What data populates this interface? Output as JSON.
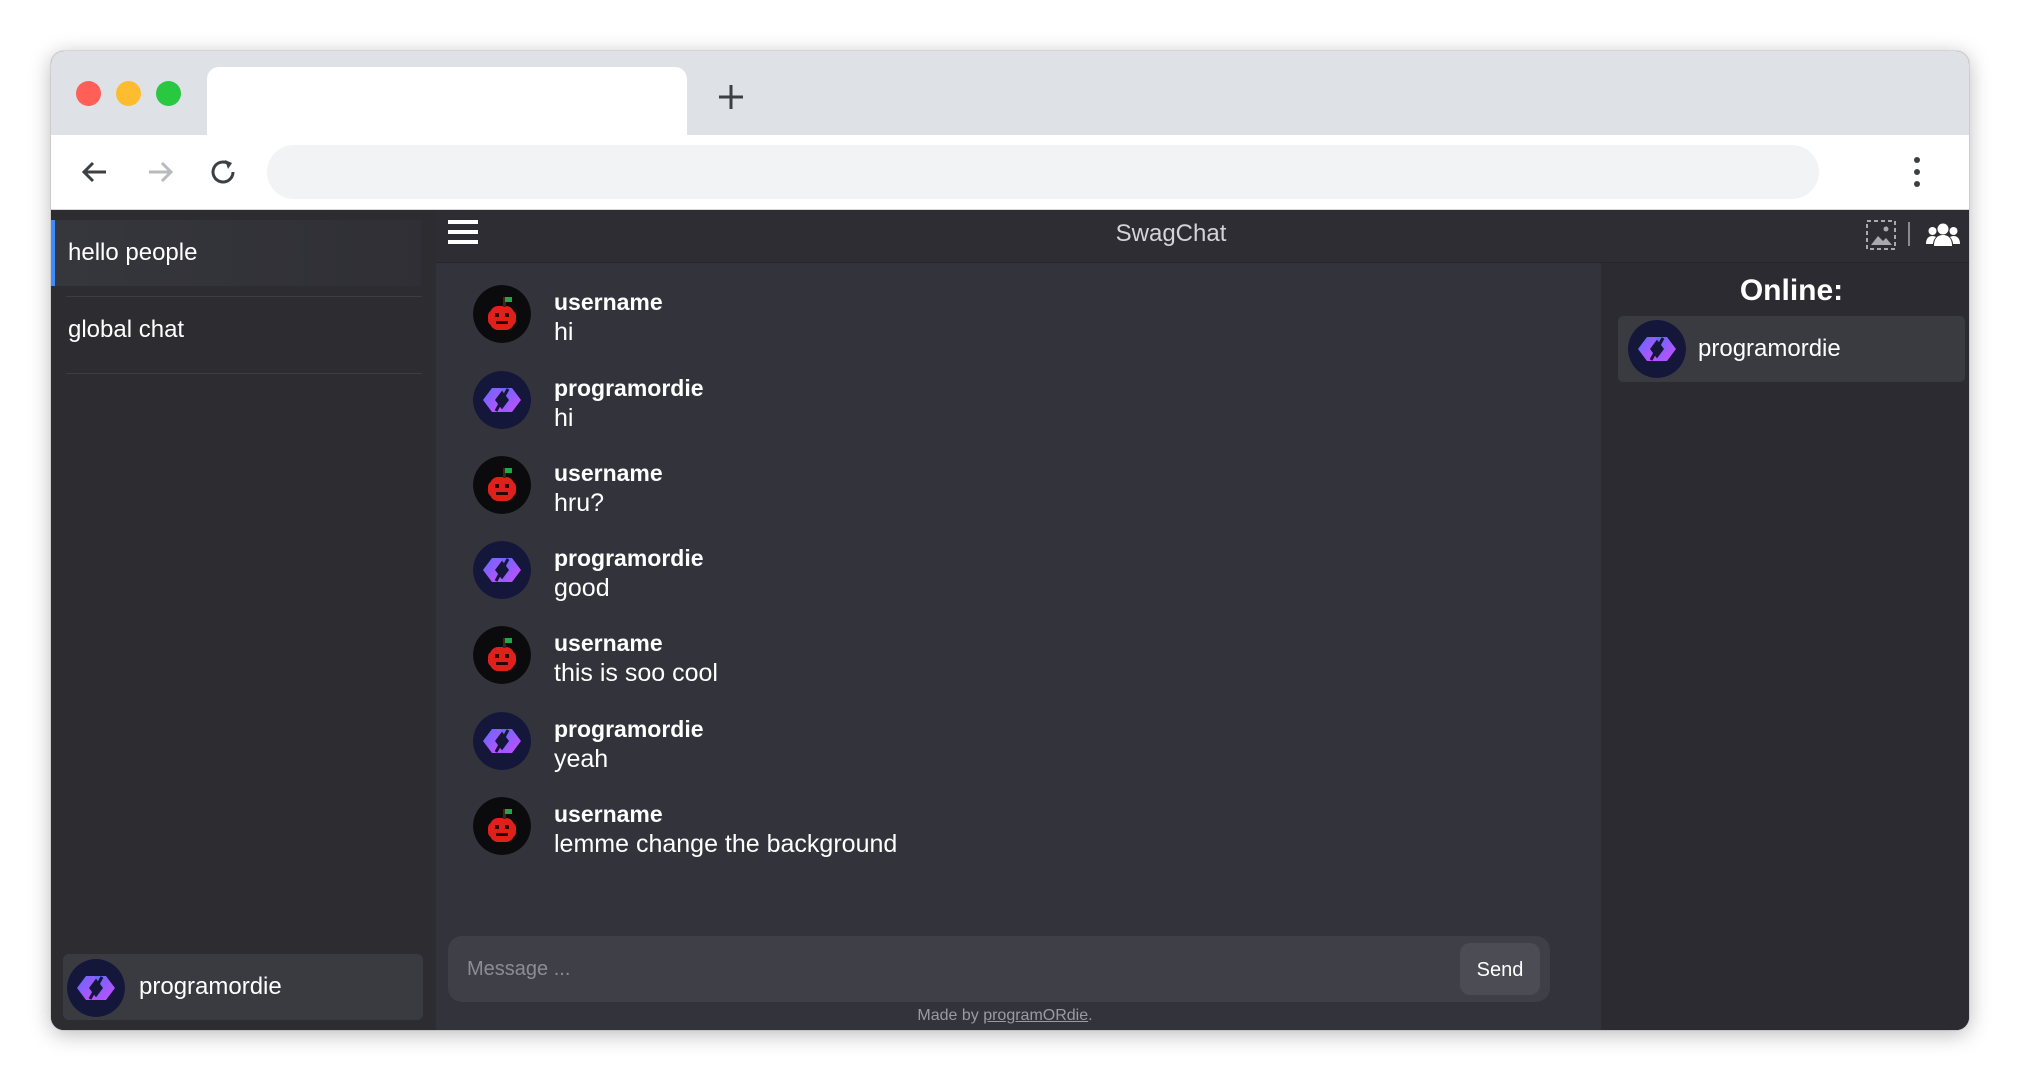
{
  "browser": {
    "tab_title": "",
    "new_tab_label": "+",
    "address": ""
  },
  "app": {
    "title": "SwagChat"
  },
  "sidebar": {
    "rooms": [
      {
        "label": "hello people",
        "active": true
      },
      {
        "label": "global chat",
        "active": false
      }
    ],
    "current_user": "programordie"
  },
  "messages": [
    {
      "author": "username",
      "text": "hi",
      "avatar": "apple-avatar"
    },
    {
      "author": "programordie",
      "text": "hi",
      "avatar": "code-logo-avatar"
    },
    {
      "author": "username",
      "text": "hru?",
      "avatar": "apple-avatar"
    },
    {
      "author": "programordie",
      "text": "good",
      "avatar": "code-logo-avatar"
    },
    {
      "author": "username",
      "text": "this is soo cool",
      "avatar": "apple-avatar"
    },
    {
      "author": "programordie",
      "text": "yeah",
      "avatar": "code-logo-avatar"
    },
    {
      "author": "username",
      "text": "lemme change the background",
      "avatar": "apple-avatar"
    }
  ],
  "composer": {
    "placeholder": "Message ...",
    "value": "",
    "send_label": "Send"
  },
  "footer": {
    "prefix": "Made by ",
    "link": "programORdie",
    "suffix": "."
  },
  "online": {
    "title": "Online:",
    "users": [
      "programordie"
    ]
  },
  "colors": {
    "accent": "#3d8bfd",
    "background": "#2b2b31",
    "chat_background": "#33333b"
  },
  "icons": [
    "menu-icon",
    "background-image-icon",
    "users-icon",
    "back-arrow-icon",
    "forward-arrow-icon",
    "reload-icon",
    "more-vertical-icon"
  ]
}
